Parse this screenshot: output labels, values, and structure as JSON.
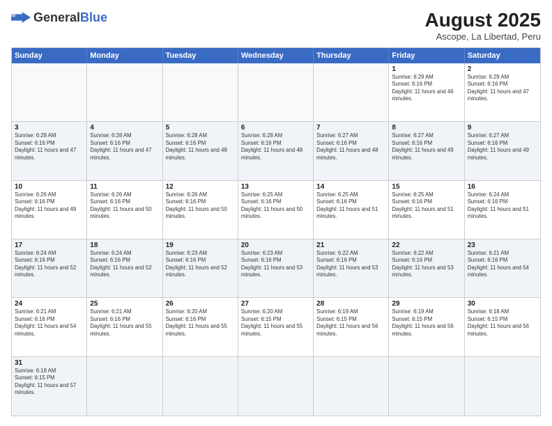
{
  "header": {
    "logo_general": "General",
    "logo_blue": "Blue",
    "month_year": "August 2025",
    "location": "Ascope, La Libertad, Peru"
  },
  "day_headers": [
    "Sunday",
    "Monday",
    "Tuesday",
    "Wednesday",
    "Thursday",
    "Friday",
    "Saturday"
  ],
  "weeks": [
    [
      {
        "date": "",
        "info": ""
      },
      {
        "date": "",
        "info": ""
      },
      {
        "date": "",
        "info": ""
      },
      {
        "date": "",
        "info": ""
      },
      {
        "date": "",
        "info": ""
      },
      {
        "date": "1",
        "info": "Sunrise: 6:29 AM\nSunset: 6:16 PM\nDaylight: 11 hours and 46 minutes."
      },
      {
        "date": "2",
        "info": "Sunrise: 6:29 AM\nSunset: 6:16 PM\nDaylight: 11 hours and 47 minutes."
      }
    ],
    [
      {
        "date": "3",
        "info": "Sunrise: 6:28 AM\nSunset: 6:16 PM\nDaylight: 11 hours and 47 minutes."
      },
      {
        "date": "4",
        "info": "Sunrise: 6:28 AM\nSunset: 6:16 PM\nDaylight: 11 hours and 47 minutes."
      },
      {
        "date": "5",
        "info": "Sunrise: 6:28 AM\nSunset: 6:16 PM\nDaylight: 11 hours and 48 minutes."
      },
      {
        "date": "6",
        "info": "Sunrise: 6:28 AM\nSunset: 6:16 PM\nDaylight: 11 hours and 48 minutes."
      },
      {
        "date": "7",
        "info": "Sunrise: 6:27 AM\nSunset: 6:16 PM\nDaylight: 11 hours and 48 minutes."
      },
      {
        "date": "8",
        "info": "Sunrise: 6:27 AM\nSunset: 6:16 PM\nDaylight: 11 hours and 49 minutes."
      },
      {
        "date": "9",
        "info": "Sunrise: 6:27 AM\nSunset: 6:16 PM\nDaylight: 11 hours and 49 minutes."
      }
    ],
    [
      {
        "date": "10",
        "info": "Sunrise: 6:26 AM\nSunset: 6:16 PM\nDaylight: 11 hours and 49 minutes."
      },
      {
        "date": "11",
        "info": "Sunrise: 6:26 AM\nSunset: 6:16 PM\nDaylight: 11 hours and 50 minutes."
      },
      {
        "date": "12",
        "info": "Sunrise: 6:26 AM\nSunset: 6:16 PM\nDaylight: 11 hours and 50 minutes."
      },
      {
        "date": "13",
        "info": "Sunrise: 6:25 AM\nSunset: 6:16 PM\nDaylight: 11 hours and 50 minutes."
      },
      {
        "date": "14",
        "info": "Sunrise: 6:25 AM\nSunset: 6:16 PM\nDaylight: 11 hours and 51 minutes."
      },
      {
        "date": "15",
        "info": "Sunrise: 6:25 AM\nSunset: 6:16 PM\nDaylight: 11 hours and 51 minutes."
      },
      {
        "date": "16",
        "info": "Sunrise: 6:24 AM\nSunset: 6:16 PM\nDaylight: 11 hours and 51 minutes."
      }
    ],
    [
      {
        "date": "17",
        "info": "Sunrise: 6:24 AM\nSunset: 6:16 PM\nDaylight: 11 hours and 52 minutes."
      },
      {
        "date": "18",
        "info": "Sunrise: 6:24 AM\nSunset: 6:16 PM\nDaylight: 11 hours and 52 minutes."
      },
      {
        "date": "19",
        "info": "Sunrise: 6:23 AM\nSunset: 6:16 PM\nDaylight: 11 hours and 52 minutes."
      },
      {
        "date": "20",
        "info": "Sunrise: 6:23 AM\nSunset: 6:16 PM\nDaylight: 11 hours and 53 minutes."
      },
      {
        "date": "21",
        "info": "Sunrise: 6:22 AM\nSunset: 6:16 PM\nDaylight: 11 hours and 53 minutes."
      },
      {
        "date": "22",
        "info": "Sunrise: 6:22 AM\nSunset: 6:16 PM\nDaylight: 11 hours and 53 minutes."
      },
      {
        "date": "23",
        "info": "Sunrise: 6:21 AM\nSunset: 6:16 PM\nDaylight: 11 hours and 54 minutes."
      }
    ],
    [
      {
        "date": "24",
        "info": "Sunrise: 6:21 AM\nSunset: 6:16 PM\nDaylight: 11 hours and 54 minutes."
      },
      {
        "date": "25",
        "info": "Sunrise: 6:21 AM\nSunset: 6:16 PM\nDaylight: 11 hours and 55 minutes."
      },
      {
        "date": "26",
        "info": "Sunrise: 6:20 AM\nSunset: 6:16 PM\nDaylight: 11 hours and 55 minutes."
      },
      {
        "date": "27",
        "info": "Sunrise: 6:20 AM\nSunset: 6:15 PM\nDaylight: 11 hours and 55 minutes."
      },
      {
        "date": "28",
        "info": "Sunrise: 6:19 AM\nSunset: 6:15 PM\nDaylight: 11 hours and 56 minutes."
      },
      {
        "date": "29",
        "info": "Sunrise: 6:19 AM\nSunset: 6:15 PM\nDaylight: 11 hours and 56 minutes."
      },
      {
        "date": "30",
        "info": "Sunrise: 6:18 AM\nSunset: 6:15 PM\nDaylight: 11 hours and 56 minutes."
      }
    ],
    [
      {
        "date": "31",
        "info": "Sunrise: 6:18 AM\nSunset: 6:15 PM\nDaylight: 11 hours and 57 minutes."
      },
      {
        "date": "",
        "info": ""
      },
      {
        "date": "",
        "info": ""
      },
      {
        "date": "",
        "info": ""
      },
      {
        "date": "",
        "info": ""
      },
      {
        "date": "",
        "info": ""
      },
      {
        "date": "",
        "info": ""
      }
    ]
  ]
}
